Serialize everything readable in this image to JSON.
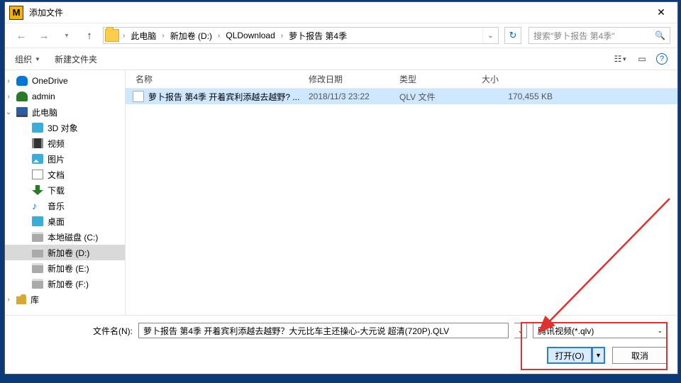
{
  "window": {
    "title": "添加文件"
  },
  "breadcrumb": {
    "items": [
      "此电脑",
      "新加卷 (D:)",
      "QLDownload",
      "萝卜报告 第4季"
    ]
  },
  "search": {
    "placeholder": "搜索\"萝卜报告 第4季\""
  },
  "toolbar": {
    "organize": "组织",
    "newfolder": "新建文件夹"
  },
  "sidebar": {
    "items": [
      {
        "label": "OneDrive"
      },
      {
        "label": "admin"
      },
      {
        "label": "此电脑"
      },
      {
        "label": "3D 对象"
      },
      {
        "label": "视频"
      },
      {
        "label": "图片"
      },
      {
        "label": "文档"
      },
      {
        "label": "下载"
      },
      {
        "label": "音乐"
      },
      {
        "label": "桌面"
      },
      {
        "label": "本地磁盘 (C:)"
      },
      {
        "label": "新加卷 (D:)"
      },
      {
        "label": "新加卷 (E:)"
      },
      {
        "label": "新加卷 (F:)"
      },
      {
        "label": "库"
      }
    ]
  },
  "columns": {
    "name": "名称",
    "date": "修改日期",
    "type": "类型",
    "size": "大小"
  },
  "files": [
    {
      "name": "萝卜报告 第4季 开着宾利添越去越野? ...",
      "date": "2018/11/3 23:22",
      "type": "QLV 文件",
      "size": "170,455 KB"
    }
  ],
  "footer": {
    "filename_label": "文件名(N):",
    "filename_value": "萝卜报告 第4季 开着宾利添越去越野？大元比车主还操心-大元说 超清(720P).QLV",
    "filter": "腾讯视频(*.qlv)",
    "open": "打开(O)",
    "cancel": "取消"
  }
}
